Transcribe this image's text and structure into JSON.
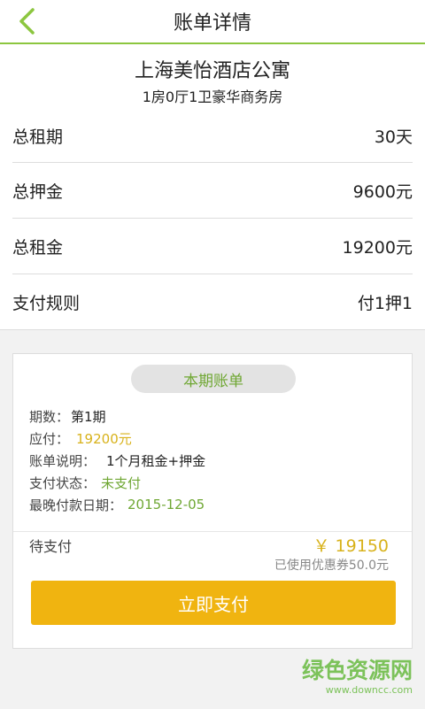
{
  "header": {
    "title": "账单详情",
    "back_icon": "chevron-left-icon",
    "accent": "#8cc63f"
  },
  "property": {
    "name": "上海美怡酒店公寓",
    "room": "1房0厅1卫豪华商务房"
  },
  "summary": [
    {
      "label": "总租期",
      "value": "30天"
    },
    {
      "label": "总押金",
      "value": "9600元"
    },
    {
      "label": "总租金",
      "value": "19200元"
    },
    {
      "label": "支付规则",
      "value": "付1押1"
    }
  ],
  "bill": {
    "section_label": "本期账单",
    "period_label": "期数：",
    "period_value": "第1期",
    "due_label": "应付：",
    "due_value": "19200元",
    "desc_label": "账单说明：",
    "desc_value": "1个月租金+押金",
    "status_label": "支付状态：",
    "status_value": "未支付",
    "deadline_label": "最晚付款日期：",
    "deadline_value": "2015-12-05",
    "pending_label": "待支付",
    "pending_amount": "￥ 19150",
    "coupon_note": "已使用优惠券50.0元",
    "pay_button": "立即支付"
  },
  "colors": {
    "green": "#6fa733",
    "amount_yellow": "#d8b21b",
    "button_orange": "#f0b410"
  },
  "watermark": {
    "title": "绿色资源网",
    "url": "www.downcc.com"
  }
}
